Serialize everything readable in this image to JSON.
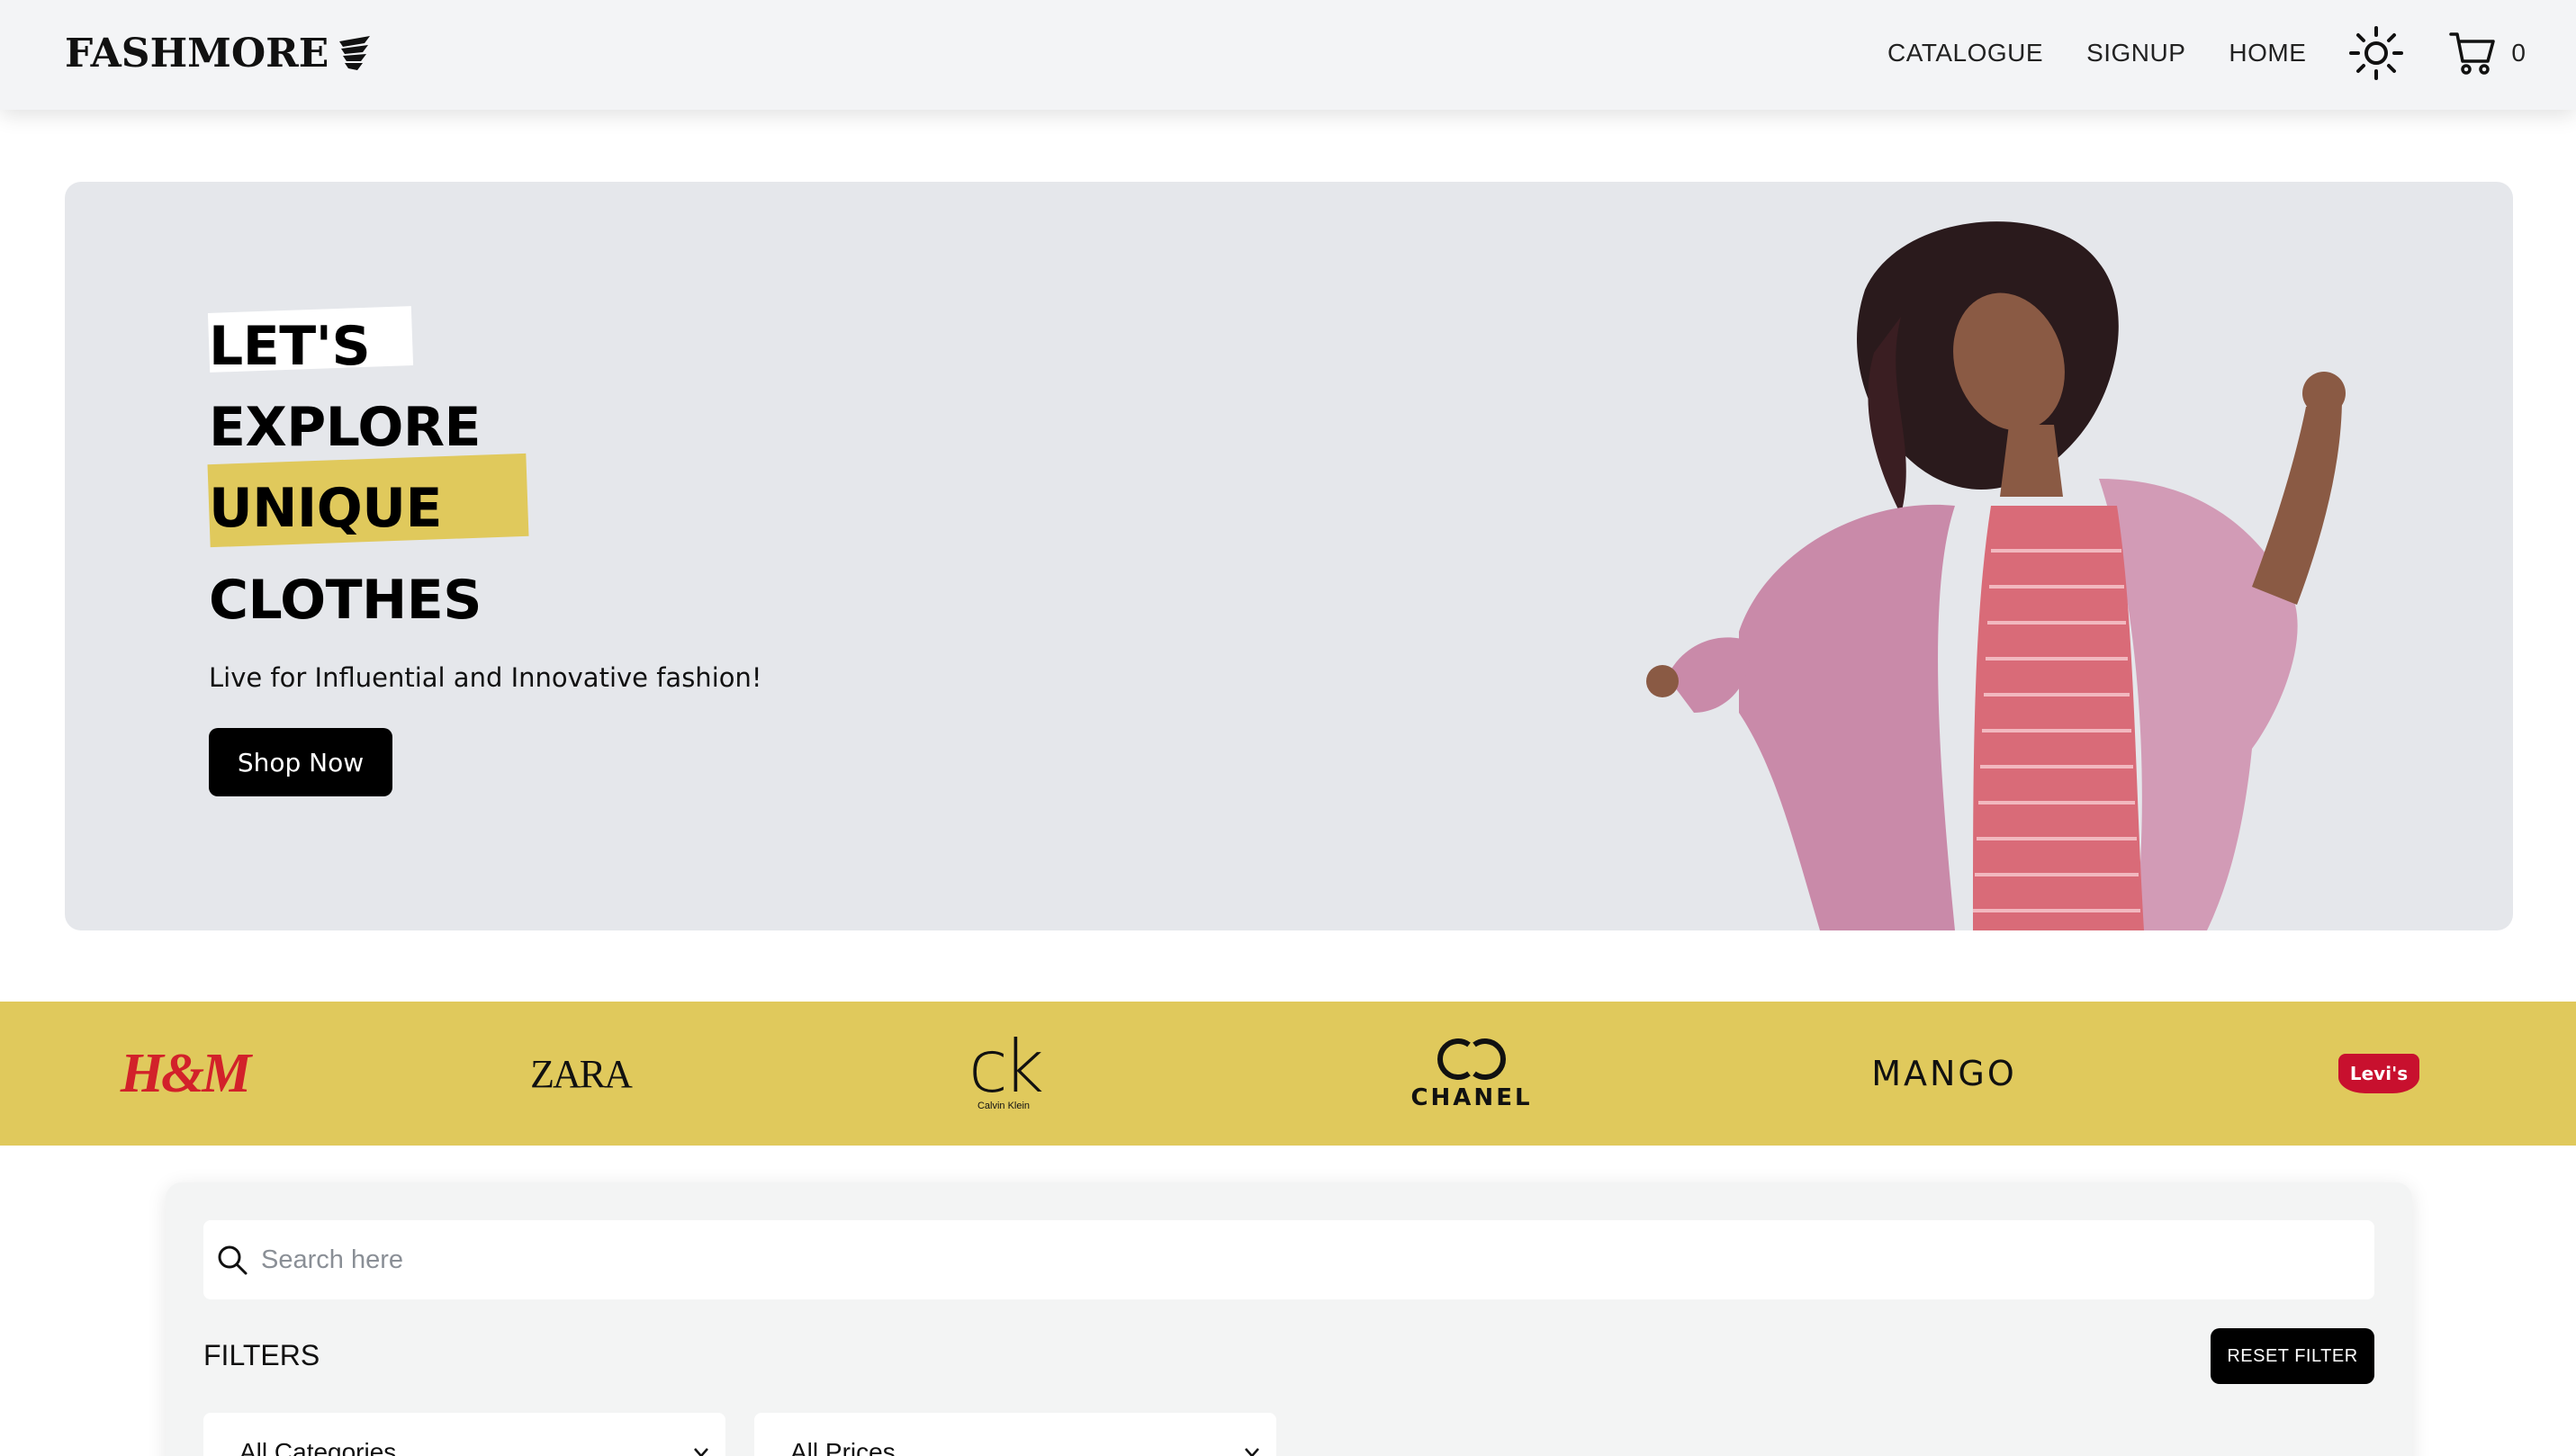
{
  "header": {
    "logo": "FASHMORE",
    "nav": [
      {
        "label": "CATALOGUE"
      },
      {
        "label": "SIGNUP"
      },
      {
        "label": "HOME"
      }
    ],
    "cart_count": "0",
    "icons": {
      "theme": "sun-icon",
      "cart": "cart-icon"
    }
  },
  "hero": {
    "lines": [
      "LET'S",
      "EXPLORE",
      "UNIQUE",
      "CLOTHES"
    ],
    "subtitle": "Live for Influential and Innovative fashion!",
    "cta": "Shop Now"
  },
  "brands": {
    "hm": "H&M",
    "zara": "ZARA",
    "ck": "ck",
    "ck_small": "Calvin Klein",
    "chanel": "CHANEL",
    "mango": "MANGO",
    "levis": "Levi's"
  },
  "filters": {
    "search_placeholder": "Search here",
    "title": "FILTERS",
    "reset_label": "RESET FILTER",
    "category_select": "All Categories",
    "price_select": "All Prices"
  },
  "colors": {
    "accent_yellow": "#e0c95c",
    "header_bg": "#f3f4f6",
    "hero_bg": "#e5e7eb",
    "button_black": "#000000"
  }
}
